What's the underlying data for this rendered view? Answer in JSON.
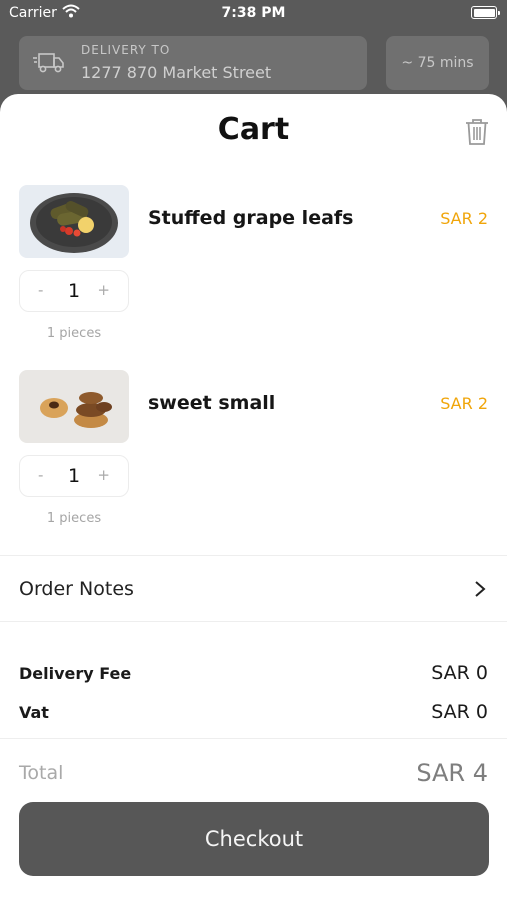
{
  "status_bar": {
    "carrier": "Carrier",
    "time": "7:38 PM"
  },
  "header": {
    "delivery_label": "DELIVERY TO",
    "delivery_address": "1277 870 Market Street",
    "eta": "~ 75 mins"
  },
  "cart": {
    "title": "Cart",
    "items": [
      {
        "name": "Stuffed grape leafs",
        "price": "SAR 2",
        "quantity": "1",
        "pieces": "1 pieces",
        "minus": "-",
        "plus": "+"
      },
      {
        "name": "sweet small",
        "price": "SAR 2",
        "quantity": "1",
        "pieces": "1 pieces",
        "minus": "-",
        "plus": "+"
      }
    ],
    "order_notes": "Order Notes",
    "fees": [
      {
        "label": "Delivery Fee",
        "value": "SAR 0"
      },
      {
        "label": "Vat",
        "value": "SAR 0"
      }
    ],
    "total_label": "Total",
    "total_value": "SAR 4",
    "checkout_label": "Checkout"
  },
  "colors": {
    "accent_price": "#f0a50a",
    "checkout_bg": "#575757",
    "overlay": "#5a5a5a"
  },
  "icons": [
    "wifi-icon",
    "battery-icon",
    "truck-icon",
    "trash-icon",
    "chevron-right-icon"
  ]
}
